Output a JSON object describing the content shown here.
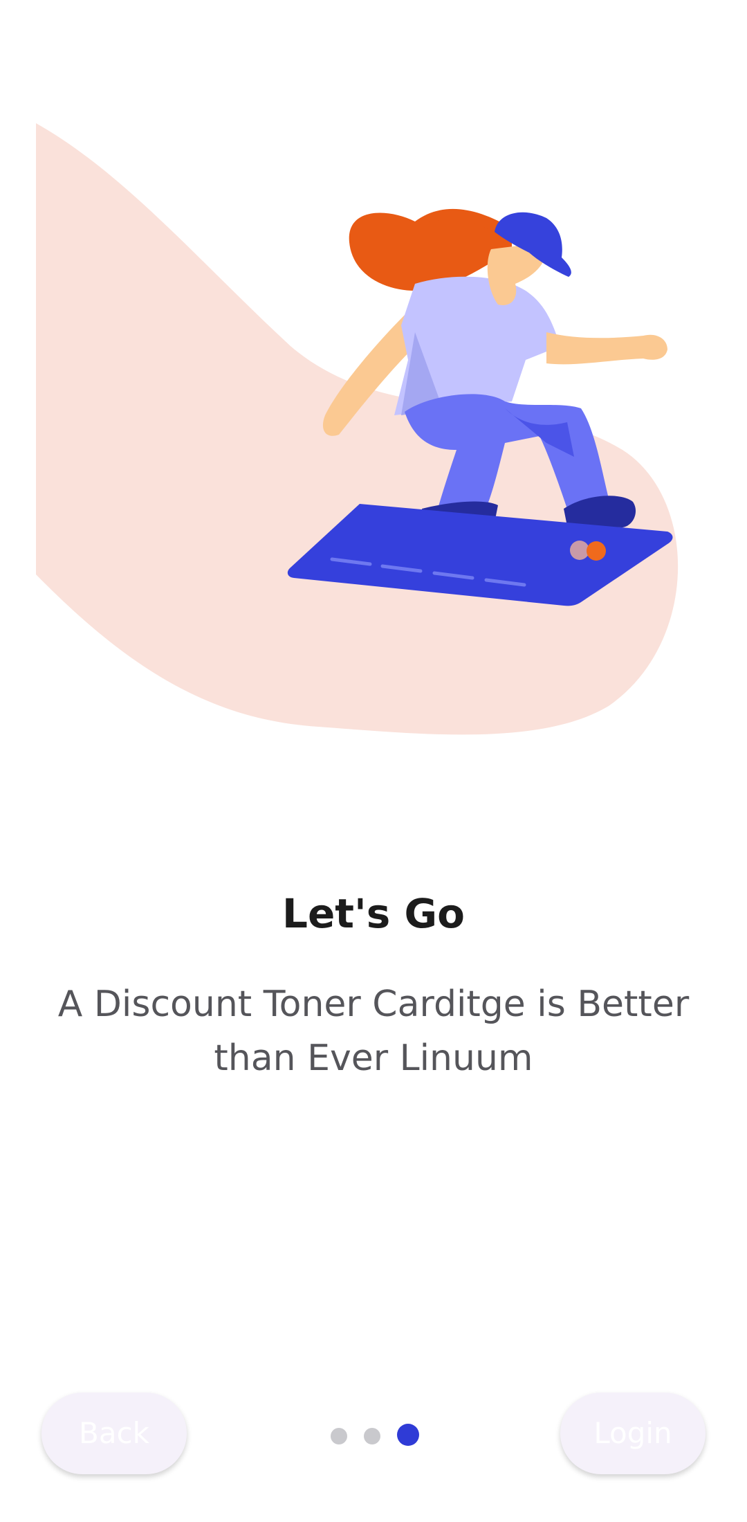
{
  "onboarding": {
    "title": "Let's Go",
    "subtitle": "A Discount Toner Carditge is Better than Ever Linuum",
    "illustration": "surfer-on-credit-card"
  },
  "navigation": {
    "back_label": "Back",
    "login_label": "Login"
  },
  "pagination": {
    "total": 3,
    "active": 3
  },
  "colors": {
    "accent": "#2f3bd6",
    "blob": "#fae1da",
    "inactive_dot": "#c9c9cd",
    "button_bg": "#f5f1fa"
  }
}
